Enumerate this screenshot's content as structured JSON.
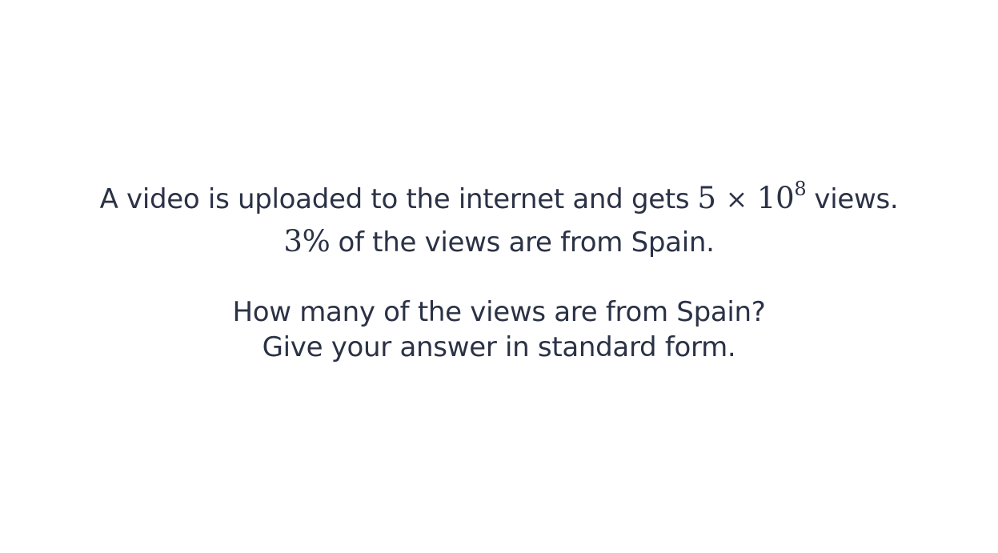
{
  "problem": {
    "line1_text": "A video is uploaded to the internet and gets",
    "views_mantissa": "5",
    "times_symbol": "×",
    "views_base": "10",
    "views_exponent": "8",
    "line1_suffix": "views.",
    "percent_value": "3%",
    "line2_text": "of the views are from Spain.",
    "question": "How many of the views are from Spain?",
    "instruction": "Give your answer in standard form."
  }
}
